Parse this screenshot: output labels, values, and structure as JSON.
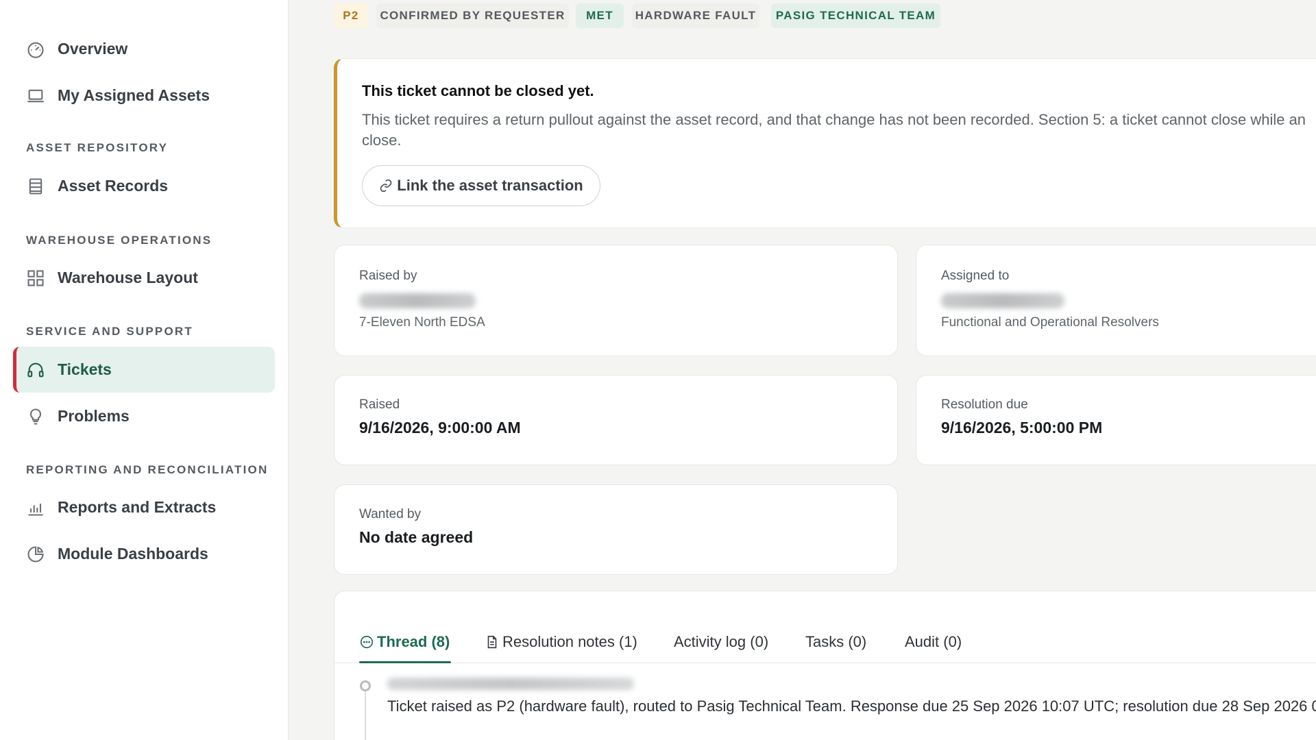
{
  "sidebar": {
    "items": [
      {
        "label": "Overview",
        "icon": "gauge-icon"
      },
      {
        "label": "My Assigned Assets",
        "icon": "laptop-icon"
      },
      {
        "label": "Asset Records",
        "icon": "records-icon"
      },
      {
        "label": "Warehouse Layout",
        "icon": "grid-icon"
      },
      {
        "label": "Tickets",
        "icon": "headset-icon",
        "active": true
      },
      {
        "label": "Problems",
        "icon": "lightbulb-icon"
      },
      {
        "label": "Reports and Extracts",
        "icon": "bar-chart-icon"
      },
      {
        "label": "Module Dashboards",
        "icon": "pie-chart-icon"
      }
    ],
    "sections": {
      "asset_repository": "ASSET REPOSITORY",
      "warehouse_operations": "WAREHOUSE OPERATIONS",
      "service_and_support": "SERVICE AND SUPPORT",
      "reporting": "REPORTING AND RECONCILIATION"
    }
  },
  "tags": {
    "priority": "P2",
    "status": "CONFIRMED BY REQUESTER",
    "sla": "MET",
    "category": "HARDWARE FAULT",
    "team": "PASIG TECHNICAL TEAM"
  },
  "alert": {
    "title": "This ticket cannot be closed yet.",
    "body_line1": "This ticket requires a return pullout against the asset record, and that change has not been recorded. Section 5: a ticket cannot close while an",
    "body_line2": "close.",
    "button": "Link the asset transaction"
  },
  "details": {
    "raised_by": {
      "label": "Raised by",
      "sub": "7-Eleven North EDSA"
    },
    "assigned_to": {
      "label": "Assigned to",
      "sub": "Functional and Operational Resolvers"
    },
    "raised": {
      "label": "Raised",
      "value": "9/16/2026, 9:00:00 AM"
    },
    "resolution_due": {
      "label": "Resolution due",
      "value": "9/16/2026, 5:00:00 PM"
    },
    "wanted_by": {
      "label": "Wanted by",
      "value": "No date agreed"
    }
  },
  "tabs": [
    {
      "label": "Thread (8)",
      "active": true
    },
    {
      "label": "Resolution notes (1)"
    },
    {
      "label": "Activity log (0)"
    },
    {
      "label": "Tasks (0)"
    },
    {
      "label": "Audit (0)"
    }
  ],
  "thread": {
    "first_entry": "Ticket raised as P2 (hardware fault), routed to Pasig Technical Team. Response due 25 Sep 2026 10:07 UTC; resolution due 28 Sep 2026 0"
  },
  "colors": {
    "accent_green": "#1e6a4e",
    "active_bg": "#e5f1ec",
    "active_marker": "#d62b39",
    "warning_border": "#c9972a"
  }
}
